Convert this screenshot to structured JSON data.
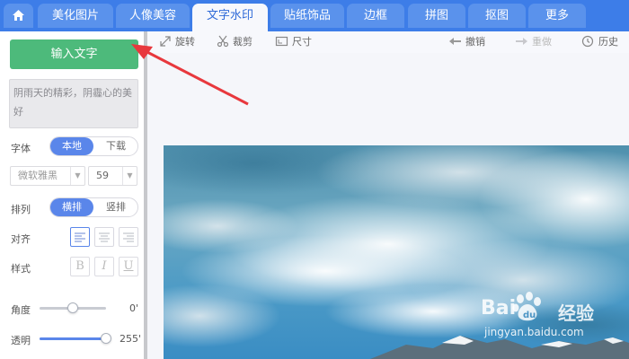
{
  "tabs": [
    {
      "id": "home",
      "label": "",
      "icon": "home-icon"
    },
    {
      "id": "beautify",
      "label": "美化图片"
    },
    {
      "id": "portrait",
      "label": "人像美容"
    },
    {
      "id": "text",
      "label": "文字水印",
      "active": true
    },
    {
      "id": "sticker",
      "label": "贴纸饰品"
    },
    {
      "id": "border",
      "label": "边框"
    },
    {
      "id": "collage",
      "label": "拼图"
    },
    {
      "id": "cutout",
      "label": "抠图"
    },
    {
      "id": "more",
      "label": "更多"
    }
  ],
  "panel": {
    "add_text_button": "输入文字",
    "text_content": "阴雨天的精彩，阴霾心的美好",
    "font": {
      "label": "字体",
      "options": [
        "本地",
        "下载"
      ],
      "selected": "本地",
      "family_value": "微软雅黑",
      "size_value": "59"
    },
    "arrange": {
      "label": "排列",
      "options": [
        "横排",
        "竖排"
      ],
      "selected": "横排"
    },
    "align": {
      "label": "对齐",
      "options_icons": [
        "align-left-icon",
        "align-center-icon",
        "align-right-icon"
      ],
      "selected": "align-left-icon"
    },
    "style": {
      "label": "样式",
      "bold": "B",
      "italic": "I",
      "underline": "U"
    },
    "angle": {
      "label": "角度",
      "value_text": "0'",
      "level": 0.5
    },
    "opacity": {
      "label": "透明",
      "value_text": "255'",
      "level": 1.0
    }
  },
  "toolbar": {
    "rotate": "旋转",
    "crop": "裁剪",
    "size": "尺寸",
    "undo": "撤销",
    "redo": "重做",
    "history": "历史"
  },
  "watermark": {
    "brand": "Bai",
    "brand_suffix": "经验",
    "url": "jingyan.baidu.com"
  },
  "colors": {
    "tab_bar": "#3d7de8",
    "accent_green": "#4dba7b",
    "accent_blue": "#5a86ea",
    "annotation_arrow": "#e8383d"
  }
}
